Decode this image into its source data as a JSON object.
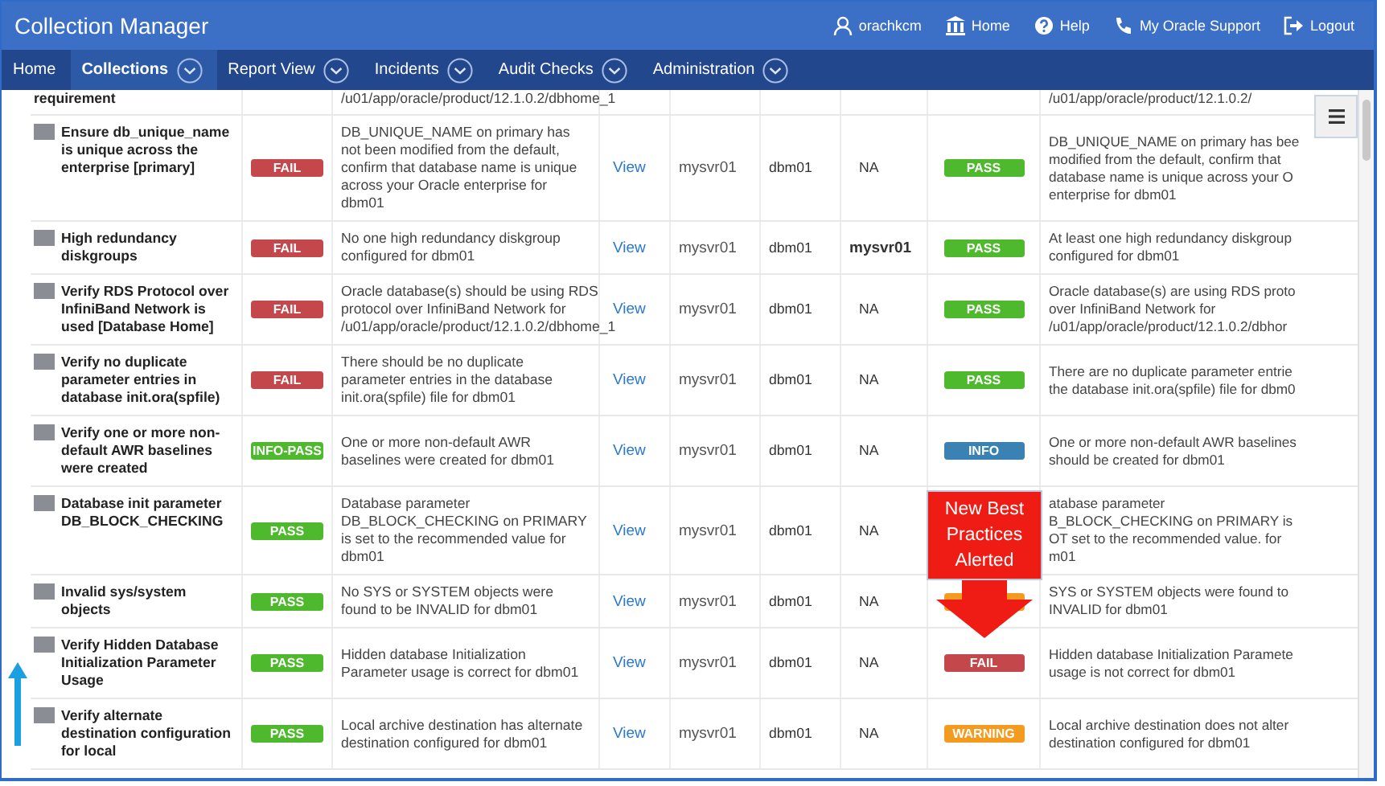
{
  "app": {
    "title": "Collection Manager"
  },
  "header_links": [
    {
      "kind": "user",
      "label": "orachkcm"
    },
    {
      "kind": "home",
      "label": "Home"
    },
    {
      "kind": "help",
      "label": "Help"
    },
    {
      "kind": "support",
      "label": "My Oracle Support"
    },
    {
      "kind": "logout",
      "label": "Logout"
    }
  ],
  "nav": [
    {
      "label": "Home",
      "selected": false,
      "dropdown": false
    },
    {
      "label": "Collections",
      "selected": true,
      "dropdown": true
    },
    {
      "label": "Report View",
      "selected": false,
      "dropdown": true
    },
    {
      "label": "Incidents",
      "selected": false,
      "dropdown": true
    },
    {
      "label": "Audit Checks",
      "selected": false,
      "dropdown": true
    },
    {
      "label": "Administration",
      "selected": false,
      "dropdown": true
    }
  ],
  "rows": [
    {
      "check": "requirement",
      "icon": false,
      "message": "/u01/app/oracle/product/12.1.0.2/dbhome_1",
      "message_2": [
        "/u01/app/oracle/product/12.1.0.2/"
      ]
    },
    {
      "check": "Ensure db_unique_name is unique across the enterprise [primary]",
      "icon": true,
      "status": {
        "kind": "fail",
        "label": "FAIL"
      },
      "message": "DB_UNIQUE_NAME on primary has not been modified from the default, confirm that database name is unique across your Oracle enterprise for dbm01",
      "link": "View",
      "host": "mysvr01",
      "database": "dbm01",
      "column_7": "NA",
      "column_7_bold": false,
      "status_2": {
        "kind": "pass",
        "label": "PASS"
      },
      "message_2": [
        "DB_UNIQUE_NAME on primary has bee",
        "modified from the default, confirm that",
        "database name is unique across your O",
        "enterprise for dbm01"
      ]
    },
    {
      "check": "High redundancy diskgroups",
      "icon": true,
      "status": {
        "kind": "fail",
        "label": "FAIL"
      },
      "message": "No one high redundancy diskgroup configured for dbm01",
      "link": "View",
      "host": "mysvr01",
      "database": "dbm01",
      "column_7": "mysvr01",
      "column_7_bold": true,
      "status_2": {
        "kind": "pass",
        "label": "PASS"
      },
      "message_2": [
        "At least one high redundancy diskgroup",
        "configured for dbm01"
      ]
    },
    {
      "check": "Verify RDS Protocol over InfiniBand Network is used [Database Home]",
      "icon": true,
      "status": {
        "kind": "fail",
        "label": "FAIL"
      },
      "message": "Oracle database(s) should be using RDS protocol over InfiniBand Network for /u01/app/oracle/product/12.1.0.2/dbhome_1",
      "link": "View",
      "host": "mysvr01",
      "database": "dbm01",
      "column_7": "NA",
      "column_7_bold": false,
      "status_2": {
        "kind": "pass",
        "label": "PASS"
      },
      "message_2": [
        "Oracle database(s) are using RDS proto",
        "over InfiniBand Network for",
        "/u01/app/oracle/product/12.1.0.2/dbhor"
      ]
    },
    {
      "check": "Verify no duplicate parameter entries in database init.ora(spfile)",
      "icon": true,
      "status": {
        "kind": "fail",
        "label": "FAIL"
      },
      "message": "There should be no duplicate parameter entries in the database init.ora(spfile) file for dbm01",
      "link": "View",
      "host": "mysvr01",
      "database": "dbm01",
      "column_7": "NA",
      "column_7_bold": false,
      "status_2": {
        "kind": "pass",
        "label": "PASS"
      },
      "message_2": [
        "There are no duplicate parameter entrie",
        "the database init.ora(spfile) file for dbm0"
      ]
    },
    {
      "check": "Verify one or more non-default AWR baselines were created",
      "icon": true,
      "status": {
        "kind": "info-pass",
        "label": "INFO-PASS"
      },
      "message": "One or more non-default AWR baselines were created for dbm01",
      "link": "View",
      "host": "mysvr01",
      "database": "dbm01",
      "column_7": "NA",
      "column_7_bold": false,
      "status_2": {
        "kind": "info",
        "label": "INFO"
      },
      "message_2": [
        "One or more non-default AWR baselines",
        "should be created for dbm01"
      ]
    },
    {
      "check": "Database init parameter DB_BLOCK_CHECKING",
      "icon": true,
      "status": {
        "kind": "pass",
        "label": "PASS"
      },
      "message": "Database parameter DB_BLOCK_CHECKING on PRIMARY is set to the recommended value for dbm01",
      "link": "View",
      "host": "mysvr01",
      "database": "dbm01",
      "column_7": "NA",
      "column_7_bold": false,
      "callout": {
        "text": "New Best Practices Alerted"
      },
      "message_2": [
        "atabase parameter",
        "B_BLOCK_CHECKING on PRIMARY is",
        "OT set to the recommended value. for",
        "m01"
      ]
    },
    {
      "check": "Invalid sys/system objects",
      "icon": true,
      "status": {
        "kind": "pass",
        "label": "PASS"
      },
      "message": "No SYS or SYSTEM objects were found to be INVALID for dbm01",
      "link": "View",
      "host": "mysvr01",
      "database": "dbm01",
      "column_7": "NA",
      "column_7_bold": false,
      "status_2": {
        "kind": "warning"
      },
      "message_2": [
        "SYS or SYSTEM objects were found to",
        "INVALID for dbm01"
      ]
    },
    {
      "check": "Verify Hidden Database Initialization Parameter Usage",
      "icon": true,
      "status": {
        "kind": "pass",
        "label": "PASS"
      },
      "message": "Hidden database Initialization Parameter usage is correct for dbm01",
      "link": "View",
      "host": "mysvr01",
      "database": "dbm01",
      "column_7": "NA",
      "column_7_bold": false,
      "status_2": {
        "kind": "fail",
        "label": "FAIL"
      },
      "message_2": [
        "Hidden database Initialization Paramete",
        "usage is not correct for dbm01"
      ]
    },
    {
      "check": "Verify alternate destination configuration for local",
      "icon": true,
      "status": {
        "kind": "pass",
        "label": "PASS"
      },
      "message": "Local archive destination has alternate destination configured for dbm01",
      "link": "View",
      "host": "mysvr01",
      "database": "dbm01",
      "column_7": "NA",
      "column_7_bold": false,
      "status_2": {
        "kind": "warning",
        "label": "WARNING"
      },
      "message_2": [
        "Local archive destination does not alter",
        "destination configured for dbm01"
      ]
    }
  ]
}
